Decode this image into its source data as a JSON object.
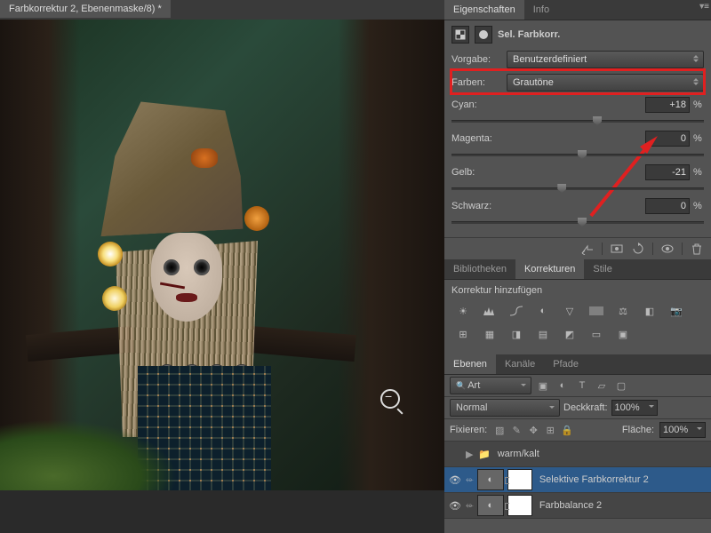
{
  "document_tab": "Farbkorrektur 2, Ebenenmaske/8) *",
  "panels": {
    "properties": {
      "tabs": [
        "Eigenschaften",
        "Info"
      ],
      "active": 0
    },
    "adjustment": {
      "title": "Sel. Farbkorr.",
      "preset_label": "Vorgabe:",
      "preset_value": "Benutzerdefiniert",
      "colors_label": "Farben:",
      "colors_value": "Grautöne",
      "sliders": [
        {
          "label": "Cyan:",
          "value": "+18",
          "pct": "%",
          "pos": 56
        },
        {
          "label": "Magenta:",
          "value": "0",
          "pct": "%",
          "pos": 50
        },
        {
          "label": "Gelb:",
          "value": "-21",
          "pct": "%",
          "pos": 42
        },
        {
          "label": "Schwarz:",
          "value": "0",
          "pct": "%",
          "pos": 50
        }
      ]
    },
    "corrections": {
      "tabs": [
        "Bibliotheken",
        "Korrekturen",
        "Stile"
      ],
      "active": 1,
      "hint": "Korrektur hinzufügen"
    },
    "layers": {
      "tabs": [
        "Ebenen",
        "Kanäle",
        "Pfade"
      ],
      "active": 0,
      "filter_label": "Art",
      "blend_mode": "Normal",
      "opacity_label": "Deckkraft:",
      "opacity_value": "100%",
      "lock_label": "Fixieren:",
      "fill_label": "Fläche:",
      "fill_value": "100%",
      "items": [
        {
          "type": "group",
          "name": "warm/kalt",
          "vis": false
        },
        {
          "type": "adj",
          "name": "Selektive Farbkorrektur 2",
          "vis": true,
          "selected": true
        },
        {
          "type": "adj",
          "name": "Farbbalance 2",
          "vis": true
        }
      ]
    }
  },
  "chart_data": null
}
